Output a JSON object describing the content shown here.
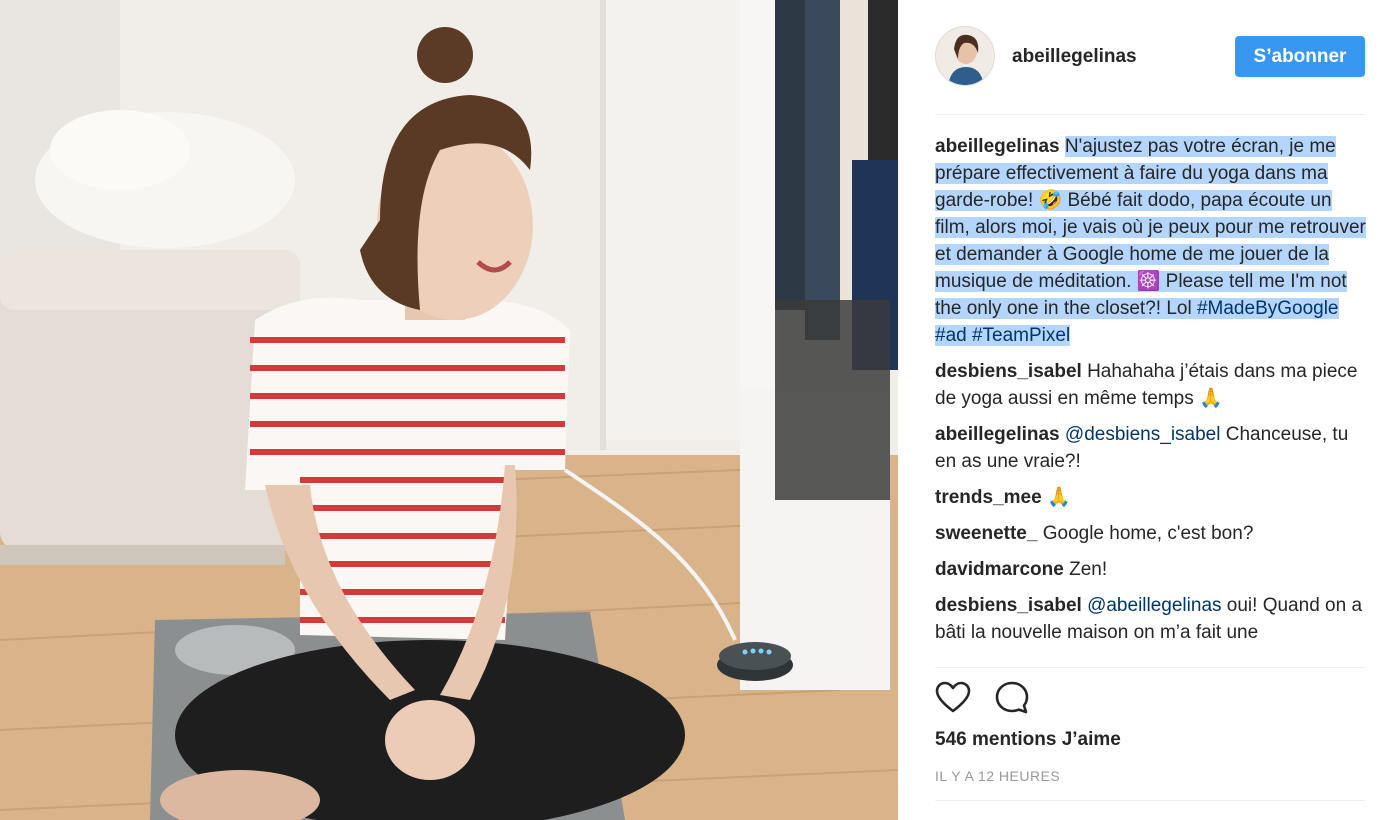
{
  "post": {
    "image_description_alt": "",
    "author": {
      "username": "abeillegelinas",
      "follow_label": "S’abonner"
    },
    "caption": {
      "username": "abeillegelinas",
      "text": "N'ajustez pas votre écran, je me prépare effectivement à faire du yoga dans ma garde-robe! 🤣 Bébé fait dodo, papa écoute un film, alors moi, je vais où je peux pour me retrouver et demander à Google home de me jouer de la musique de méditation. ☸️ Please tell me I'm not the only one in the closet?! Lol ",
      "hashtags": [
        "#MadeByGoogle",
        "#ad",
        "#TeamPixel"
      ]
    },
    "comments": [
      {
        "username": "desbiens_isabel",
        "text": "Hahahaha j’étais dans ma piece de yoga aussi en même temps 🙏",
        "mention": ""
      },
      {
        "username": "abeillegelinas",
        "mention": "@desbiens_isabel",
        "text": "Chanceuse, tu en as une vraie?!"
      },
      {
        "username": "trends_mee",
        "text": "🙏",
        "mention": ""
      },
      {
        "username": "sweenette_",
        "text": "Google home, c'est bon?",
        "mention": ""
      },
      {
        "username": "davidmarcone",
        "text": "Zen!",
        "mention": ""
      },
      {
        "username": "desbiens_isabel",
        "mention": "@abeillegelinas",
        "text": "oui! Quand on a bâti la nouvelle maison on m’a fait une"
      }
    ],
    "actions": {
      "like_icon": "heart-icon",
      "comment_icon": "comment-bubble-icon"
    },
    "likes_label": "546 mentions J’aime",
    "timestamp": "IL Y A 12 HEURES"
  },
  "colors": {
    "follow_button": "#3897f0",
    "selection_highlight": "#b4d5fe",
    "link": "#003569"
  }
}
